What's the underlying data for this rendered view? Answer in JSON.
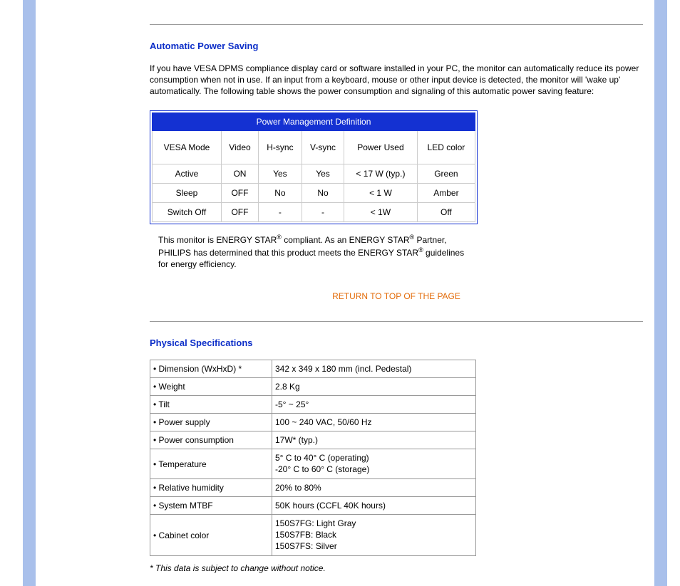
{
  "aps": {
    "heading": "Automatic Power Saving",
    "intro": "If you have VESA DPMS compliance display card or software installed in your PC, the monitor can automatically reduce its power consumption when not in use. If an input from a keyboard, mouse or other input device is detected, the monitor will 'wake up' automatically. The following table shows the power consumption and signaling of this automatic power saving feature:",
    "table_title": "Power Management Definition",
    "headers": [
      "VESA Mode",
      "Video",
      "H-sync",
      "V-sync",
      "Power Used",
      "LED color"
    ],
    "rows": [
      [
        "Active",
        "ON",
        "Yes",
        "Yes",
        "< 17 W (typ.)",
        "Green"
      ],
      [
        "Sleep",
        "OFF",
        "No",
        "No",
        "< 1 W",
        "Amber"
      ],
      [
        "Switch Off",
        "OFF",
        "-",
        "-",
        "< 1W",
        "Off"
      ]
    ],
    "compliance_pre": "This monitor is ENERGY STAR",
    "compliance_mid": " compliant. As an ENERGY STAR",
    "compliance_mid2": " Partner, PHILIPS has determined that this product meets the ENERGY STAR",
    "compliance_end": " guidelines for energy efficiency."
  },
  "return_link": "RETURN TO TOP OF THE PAGE",
  "phys": {
    "heading": "Physical Specifications",
    "rows": [
      {
        "label": "• Dimension (WxHxD) *",
        "value": "342 x 349 x 180 mm (incl. Pedestal)"
      },
      {
        "label": "• Weight",
        "value": "2.8 Kg"
      },
      {
        "label": "• Tilt",
        "value": "-5° ~ 25°"
      },
      {
        "label": "• Power supply",
        "value": "100 ~ 240 VAC, 50/60 Hz"
      },
      {
        "label": "• Power consumption",
        "value": "17W* (typ.)"
      },
      {
        "label": "• Temperature",
        "value": "5° C to 40° C (operating)\n-20° C to 60° C (storage)"
      },
      {
        "label": "• Relative humidity",
        "value": "20% to 80%"
      },
      {
        "label": "• System MTBF",
        "value": "50K hours (CCFL 40K hours)"
      },
      {
        "label": "• Cabinet color",
        "value": "150S7FG: Light Gray\n150S7FB: Black\n150S7FS: Silver"
      }
    ],
    "footnote": "* This data is subject to change without notice."
  }
}
